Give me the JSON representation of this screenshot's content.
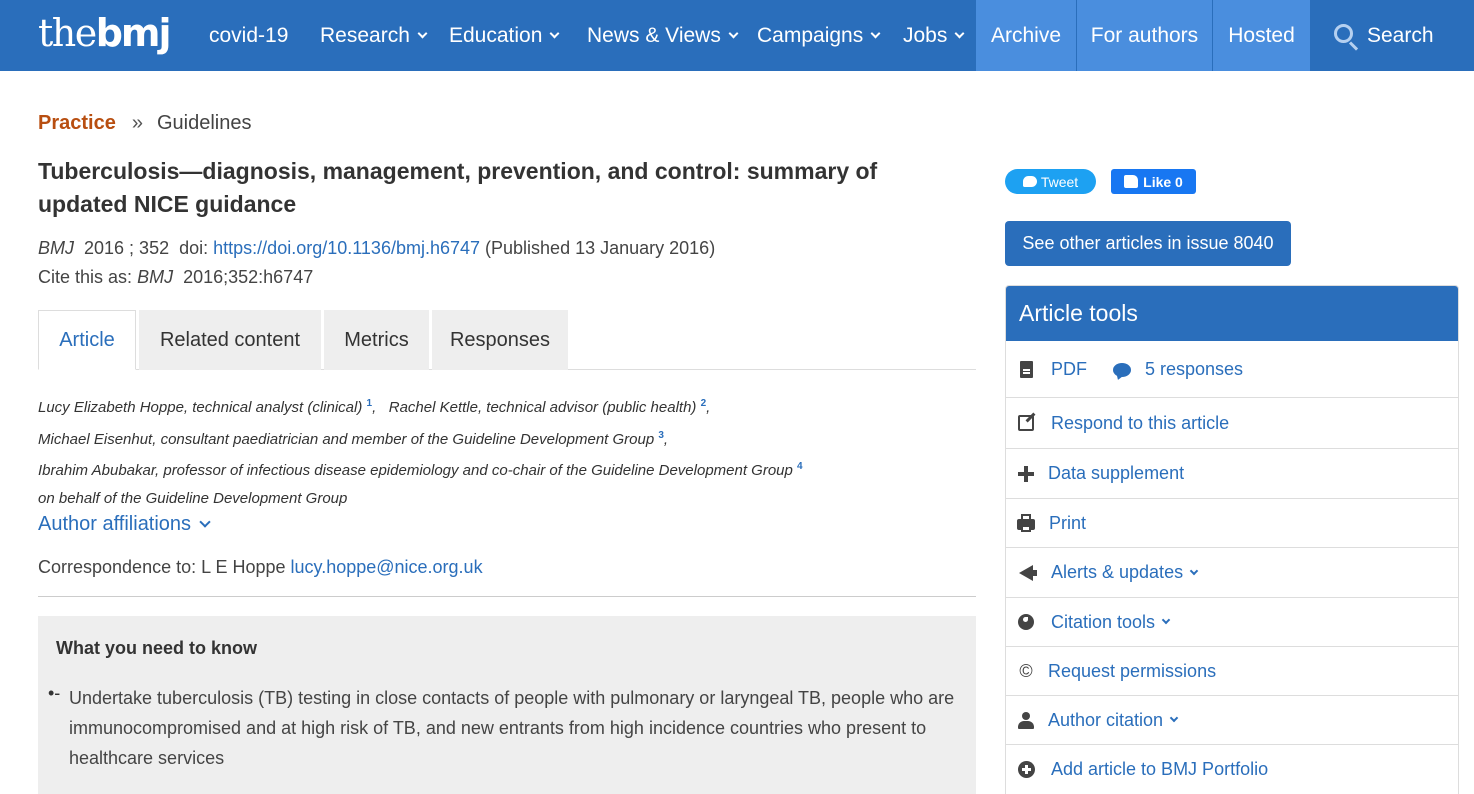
{
  "nav": {
    "logo_light": "the",
    "logo_bold": "bmj",
    "items": [
      {
        "label": "covid-19"
      },
      {
        "label": "Research"
      },
      {
        "label": "Education"
      },
      {
        "label": "News & Views"
      },
      {
        "label": "Campaigns"
      },
      {
        "label": "Jobs"
      },
      {
        "label": "Archive"
      },
      {
        "label": "For authors"
      },
      {
        "label": "Hosted"
      },
      {
        "label": "Search"
      }
    ],
    "colors": {
      "bar": "#2a6ebb",
      "highlight": "#4a8ede"
    }
  },
  "breadcrumb": {
    "section": "Practice",
    "separator": "»",
    "page": "Guidelines"
  },
  "article": {
    "title": "Tuberculosis—diagnosis, management, prevention, and control: summary of updated NICE guidance",
    "journal": "BMJ",
    "year_vol": "2016 ; 352",
    "doi_label": "doi:",
    "doi_url": "https://doi.org/10.1136/bmj.h6747",
    "published": "(Published 13 January 2016)",
    "cite_label": "Cite this as:",
    "cite_journal": "BMJ",
    "cite_ref": "2016;352:h6747",
    "tabs": [
      {
        "label": "Article"
      },
      {
        "label": "Related content"
      },
      {
        "label": "Metrics"
      },
      {
        "label": "Responses"
      }
    ],
    "authors": [
      {
        "name": "Lucy Elizabeth Hoppe, technical analyst (clinical)",
        "sup": "1"
      },
      {
        "name": "Rachel Kettle, technical advisor (public health)",
        "sup": "2"
      },
      {
        "name": "Michael Eisenhut, consultant paediatrician and member of the Guideline Development Group",
        "sup": "3"
      },
      {
        "name": "Ibrahim Abubakar, professor of infectious disease epidemiology and co-chair of the Guideline Development Group",
        "sup": "4"
      }
    ],
    "on_behalf": "on behalf of the Guideline Development Group",
    "affiliations_label": "Author affiliations",
    "correspondence_label": "Correspondence to: L E Hoppe",
    "correspondence_email": "lucy.hoppe@nice.org.uk",
    "box": {
      "heading": "What you need to know",
      "bullet": "•-",
      "item": "Undertake tuberculosis (TB) testing in close contacts of people with pulmonary or laryngeal TB, people who are immunocompromised and at high risk of TB, and new entrants from high incidence countries who present to healthcare services"
    }
  },
  "sidebar": {
    "tweet_label": "Tweet",
    "like_label": "Like 0",
    "issue_button": "See other articles in issue 8040",
    "tools_title": "Article tools",
    "pdf_label": "PDF",
    "responses_label": "5 responses",
    "tools": [
      {
        "label": "Respond to this article",
        "icon": "edit-icon"
      },
      {
        "label": "Data supplement",
        "icon": "plus-icon"
      },
      {
        "label": "Print",
        "icon": "print-icon"
      },
      {
        "label": "Alerts & updates",
        "icon": "megaphone-icon"
      },
      {
        "label": "Citation tools",
        "icon": "globe-icon"
      },
      {
        "label": "Request permissions",
        "icon": "copyright-icon"
      },
      {
        "label": "Author citation",
        "icon": "user-icon"
      },
      {
        "label": "Add article to BMJ Portfolio",
        "icon": "plus-circle-icon"
      }
    ],
    "copyright_glyph": "©"
  }
}
